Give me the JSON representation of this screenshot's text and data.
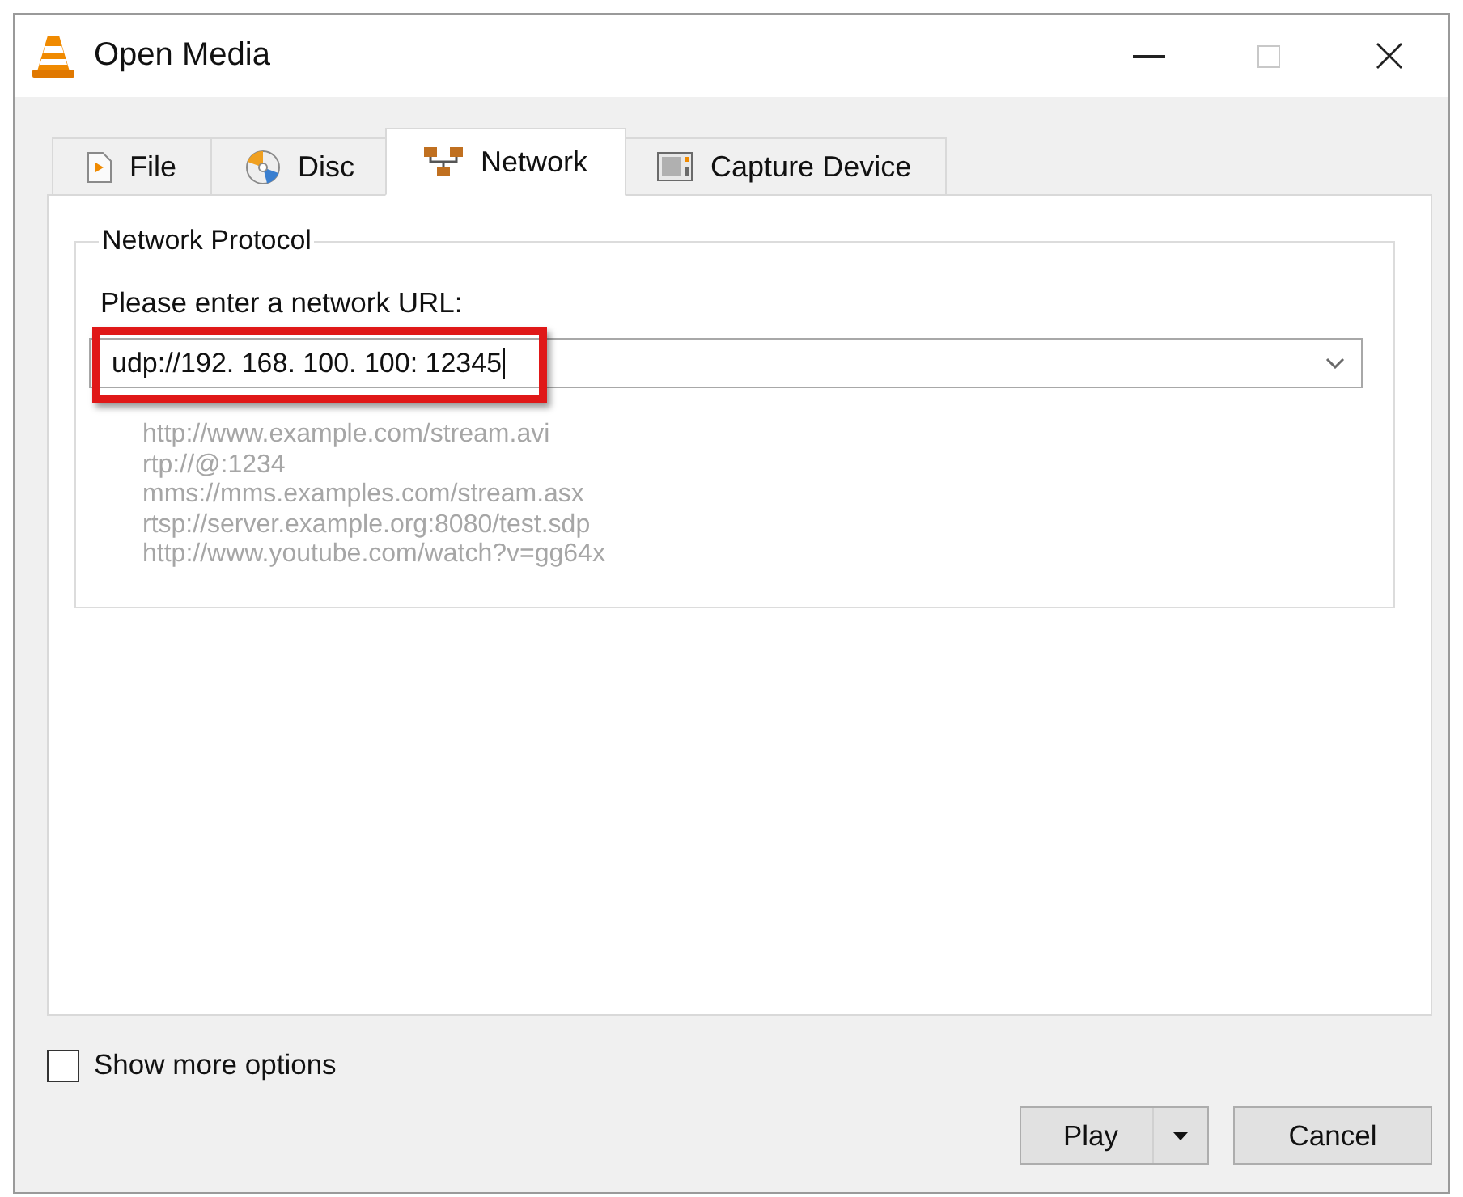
{
  "window": {
    "title": "Open Media",
    "controls": [
      {
        "kind": "minimize",
        "disabled": false
      },
      {
        "kind": "maximize",
        "disabled": true
      },
      {
        "kind": "close",
        "disabled": false
      }
    ]
  },
  "tabs": [
    {
      "label": "File",
      "kind": "file",
      "selected": false
    },
    {
      "label": "Disc",
      "kind": "disc",
      "selected": false
    },
    {
      "label": "Network",
      "kind": "network",
      "selected": true
    },
    {
      "label": "Capture Device",
      "kind": "capture",
      "selected": false
    }
  ],
  "network_protocol": {
    "title": "Network Protocol",
    "prompt": "Please enter a network URL:",
    "url_field": {
      "value": "udp://192. 168. 100. 100: 12345",
      "highlighted": true,
      "focused": true
    },
    "examples": [
      "http://www.example.com/stream.avi",
      "rtp://@:1234",
      "mms://mms.examples.com/stream.asx",
      "rtsp://server.example.org:8080/test.sdp",
      "http://www.youtube.com/watch?v=gg64x"
    ]
  },
  "show_more_options": {
    "label": "Show more options",
    "checked": false
  },
  "buttons": [
    {
      "label": "Play",
      "kind": "split"
    },
    {
      "label": "Cancel",
      "kind": "plain"
    }
  ]
}
